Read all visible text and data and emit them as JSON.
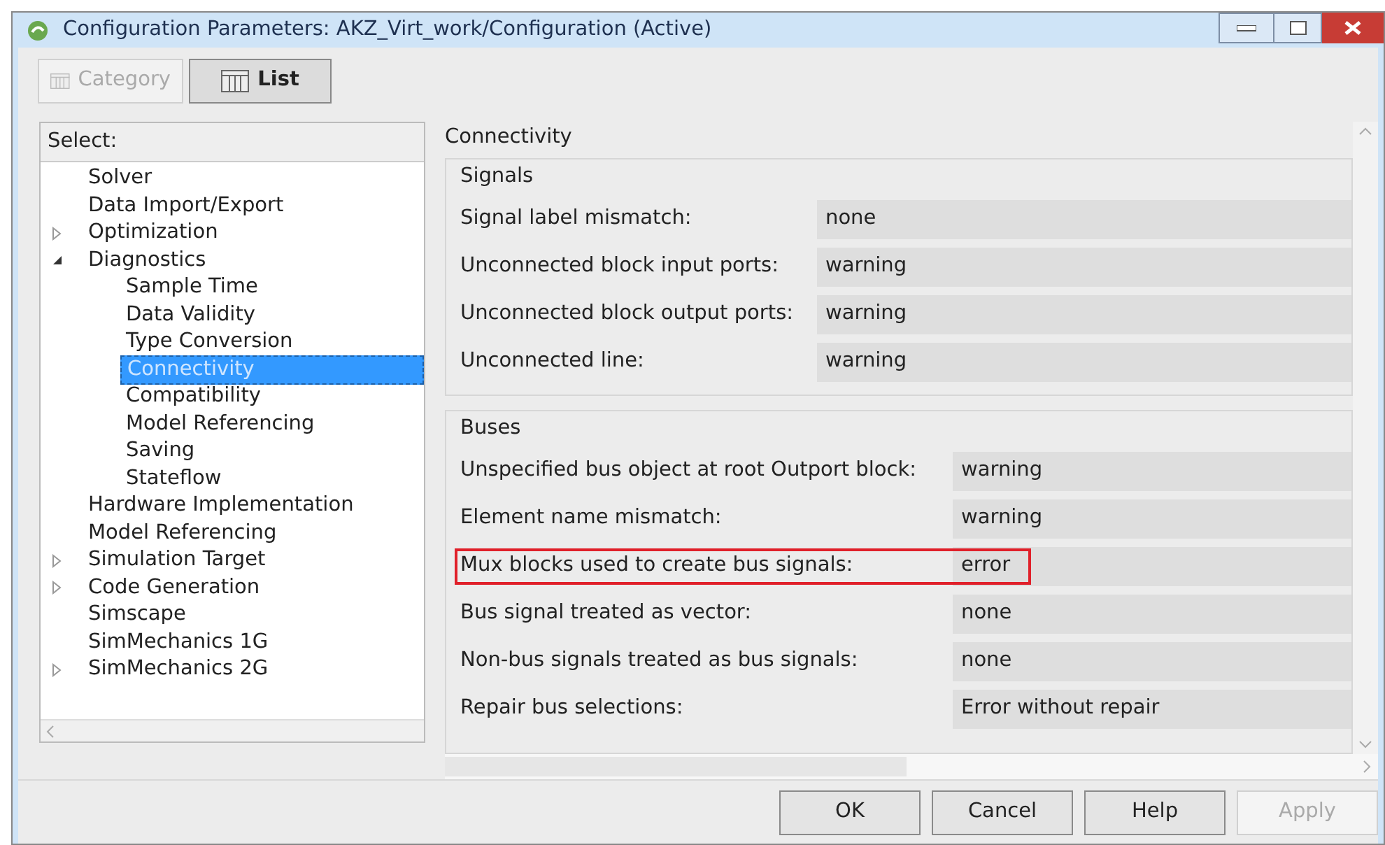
{
  "window": {
    "title": "Configuration Parameters: AKZ_Virt_work/Configuration (Active)"
  },
  "view_buttons": [
    {
      "label": "Category",
      "selected": false,
      "disabled": true
    },
    {
      "label": "List",
      "selected": true,
      "disabled": false
    }
  ],
  "tree": {
    "header": "Select:",
    "items": [
      {
        "label": "Solver",
        "selected": false
      },
      {
        "label": "Data Import/Export",
        "selected": false
      },
      {
        "label": "Optimization",
        "selected": false,
        "expanded": false
      },
      {
        "label": "Diagnostics",
        "selected": false,
        "expanded": true,
        "children": [
          {
            "label": "Sample Time",
            "selected": false
          },
          {
            "label": "Data Validity",
            "selected": false
          },
          {
            "label": "Type Conversion",
            "selected": false
          },
          {
            "label": "Connectivity",
            "selected": true
          },
          {
            "label": "Compatibility",
            "selected": false
          },
          {
            "label": "Model Referencing",
            "selected": false
          },
          {
            "label": "Saving",
            "selected": false
          },
          {
            "label": "Stateflow",
            "selected": false
          }
        ]
      },
      {
        "label": "Hardware Implementation",
        "selected": false
      },
      {
        "label": "Model Referencing",
        "selected": false
      },
      {
        "label": "Simulation Target",
        "selected": false,
        "expanded": false
      },
      {
        "label": "Code Generation",
        "selected": false,
        "expanded": false
      },
      {
        "label": "Simscape",
        "selected": false
      },
      {
        "label": "SimMechanics 1G",
        "selected": false
      },
      {
        "label": "SimMechanics 2G",
        "selected": false,
        "expanded": false
      }
    ]
  },
  "pane": {
    "title": "Connectivity",
    "groups": [
      {
        "title": "Signals",
        "rows": [
          {
            "label": "Signal label mismatch:",
            "value": "none",
            "highlighted": false
          },
          {
            "label": "Unconnected block input ports:",
            "value": "warning",
            "highlighted": false
          },
          {
            "label": "Unconnected block output ports:",
            "value": "warning",
            "highlighted": false
          },
          {
            "label": "Unconnected line:",
            "value": "warning",
            "highlighted": false
          }
        ]
      },
      {
        "title": "Buses",
        "rows": [
          {
            "label": "Unspecified bus object at root Outport block:",
            "value": "warning",
            "highlighted": false
          },
          {
            "label": "Element name mismatch:",
            "value": "warning",
            "highlighted": false
          },
          {
            "label": "Mux blocks used to create bus signals:",
            "value": "error",
            "highlighted": true
          },
          {
            "label": "Bus signal treated as vector:",
            "value": "none",
            "highlighted": false
          },
          {
            "label": "Non-bus signals treated as bus signals:",
            "value": "none",
            "highlighted": false
          },
          {
            "label": "Repair bus selections:",
            "value": "Error without repair",
            "highlighted": false
          }
        ]
      }
    ]
  },
  "buttons": [
    {
      "label": "OK",
      "disabled": false
    },
    {
      "label": "Cancel",
      "disabled": false
    },
    {
      "label": "Help",
      "disabled": false
    },
    {
      "label": "Apply",
      "disabled": true
    }
  ]
}
